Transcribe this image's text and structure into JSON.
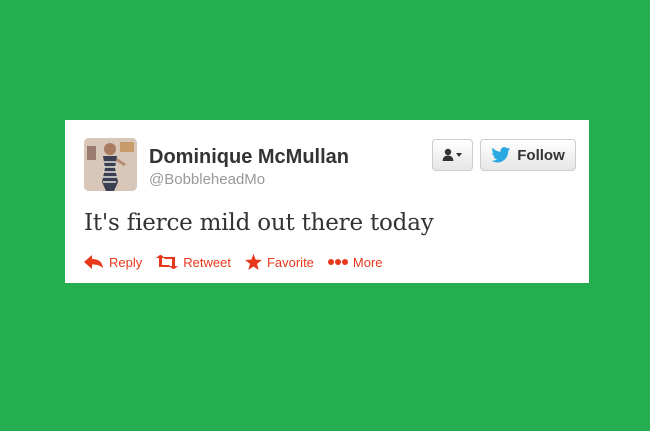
{
  "tweet": {
    "author_name": "Dominique McMullan",
    "author_handle": "@BobbleheadMo",
    "text": "It's fierce mild out there today"
  },
  "buttons": {
    "follow_label": "Follow",
    "user_menu_icon": "person-dropdown-icon",
    "follow_icon": "twitter-bird-icon"
  },
  "actions": [
    {
      "label": "Reply",
      "icon": "reply-arrow-icon"
    },
    {
      "label": "Retweet",
      "icon": "retweet-icon"
    },
    {
      "label": "Favorite",
      "icon": "star-icon"
    },
    {
      "label": "More",
      "icon": "ellipsis-icon"
    }
  ],
  "colors": {
    "background": "#24ae4f",
    "card": "#ffffff",
    "action": "#e8381b",
    "twitter_blue": "#2aa9e0"
  }
}
